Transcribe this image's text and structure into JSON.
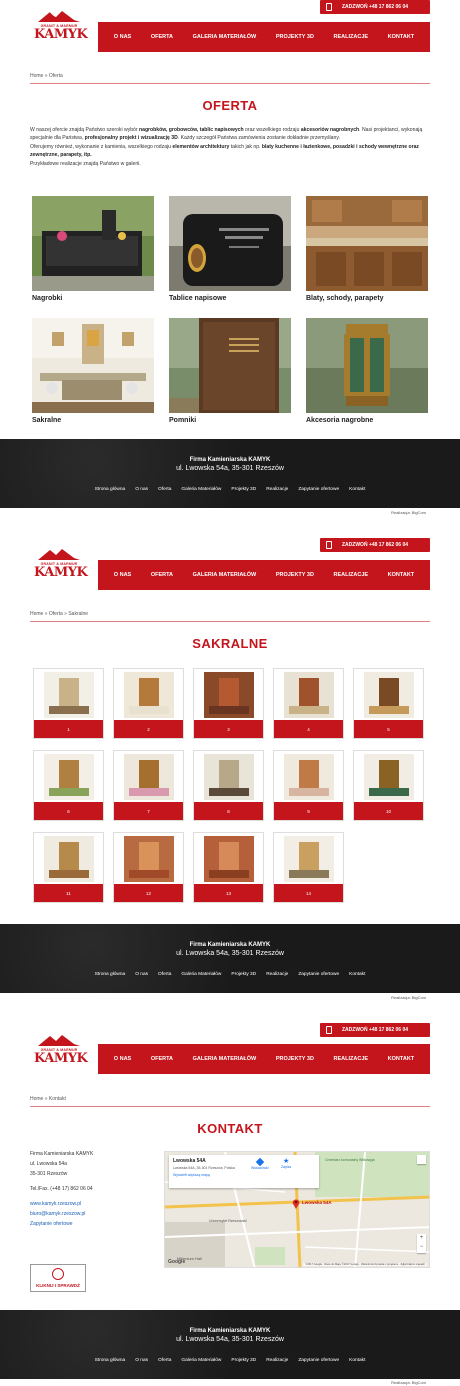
{
  "phone_bar": "ZADZWOŃ +48 17 862 06 04",
  "logo": {
    "sub": "GRANIT & MARMUR",
    "brand": "KAMYK"
  },
  "nav": [
    "O NAS",
    "OFERTA",
    "GALERIA MATERIAŁÓW",
    "PROJEKTY 3D",
    "REALIZACJE",
    "KONTAKT"
  ],
  "colors": {
    "accent": "#c4151c",
    "footer": "#1a1a1a",
    "link": "#1a5fb4"
  },
  "oferta": {
    "breadcrumb": "Home » Oferta",
    "title": "OFERTA",
    "p1a": "W naszej ofercie znajdą Państwo szeroki wybór ",
    "p1b": "nagrobków, grobowców, tablic napisowych",
    "p1c": " oraz wszelkiego rodzaju ",
    "p1d": "akcesoriów nagrobnych",
    "p1e": ". Nasi projektanci, wykonają specjalnie dla Państwa, ",
    "p1f": "profesjonalny projekt i wizualizację 3D",
    "p1g": ". Każdy szczegół Państwa zamówienia zostanie dokładnie przemyślany.",
    "p2a": "Oferujemy również, wykonanie z kamienia, wszelkiego rodzaju ",
    "p2b": "elementów architektury",
    "p2c": " takich jak np. ",
    "p2d": "blaty kuchenne i łazienkowe, posadzki i schody wewnętrzne oraz zewnętrzne, parapety, itp.",
    "p3": "Przykładowe realizacje znajdą Państwo w galerii.",
    "categories": [
      "Nagrobki",
      "Tablice napisowe",
      "Blaty, schody, parapety",
      "Sakralne",
      "Pomniki",
      "Akcesoria nagrobne"
    ]
  },
  "sakralne": {
    "breadcrumb": "Home » Oferta » Sakralne",
    "title": "SAKRALNE",
    "items": [
      "1",
      "2",
      "3",
      "4",
      "5",
      "6",
      "7",
      "8",
      "9",
      "10",
      "11",
      "12",
      "13",
      "14"
    ]
  },
  "kontakt": {
    "breadcrumb": "Home » Kontakt",
    "title": "KONTAKT",
    "company": "Firma Kamieniarska KAMYK",
    "street": "ul. Lwowska 54a",
    "city": "35-301 Rzeszów",
    "phone": "Tel./Fax. (+48 17) 862 06 04",
    "www": "www.kamyk.rzeszow.pl",
    "email": "biuro@kamyk.rzeszow.pl",
    "form": "Zapytanie ofertowe",
    "badge": "KLIKNIJ I SPRAWDŹ",
    "map": {
      "place": "Lwowska 54A",
      "addr": "Lwowska 54A, 35-301 Rzeszów, Polska",
      "dir": "Wskazówki",
      "save": "Zapisz",
      "bigger": "Wyświetl większą mapę",
      "pin": "Lwowska 54A",
      "cemetery": "Cmentarz komunalny Wilkowyja",
      "uni": "Uniwersytet Rzeszowski",
      "mall": "Millenium Hall",
      "footer": "©2017 Google · Dane do Mapy ©2017 Google · Warunki korzystania z programu · Zgłoś błąd w mapach",
      "google": "Google",
      "zoom_in": "+",
      "zoom_out": "−"
    }
  },
  "footer": {
    "name": "Firma Kamieniarska KAMYK",
    "address1": "ul. Lwowska 54a, 35-301 Rzeszów",
    "address2": "ul. Lwowska 54a, 35-301 Rzeszów",
    "links": [
      "Strona główna",
      "O nas",
      "Oferta",
      "Galeria Materiałów",
      "Projekty 3D",
      "Realizacje",
      "Zapytanie ofertowe",
      "Kontakt"
    ],
    "credit": "Realizacja: BigCom"
  }
}
